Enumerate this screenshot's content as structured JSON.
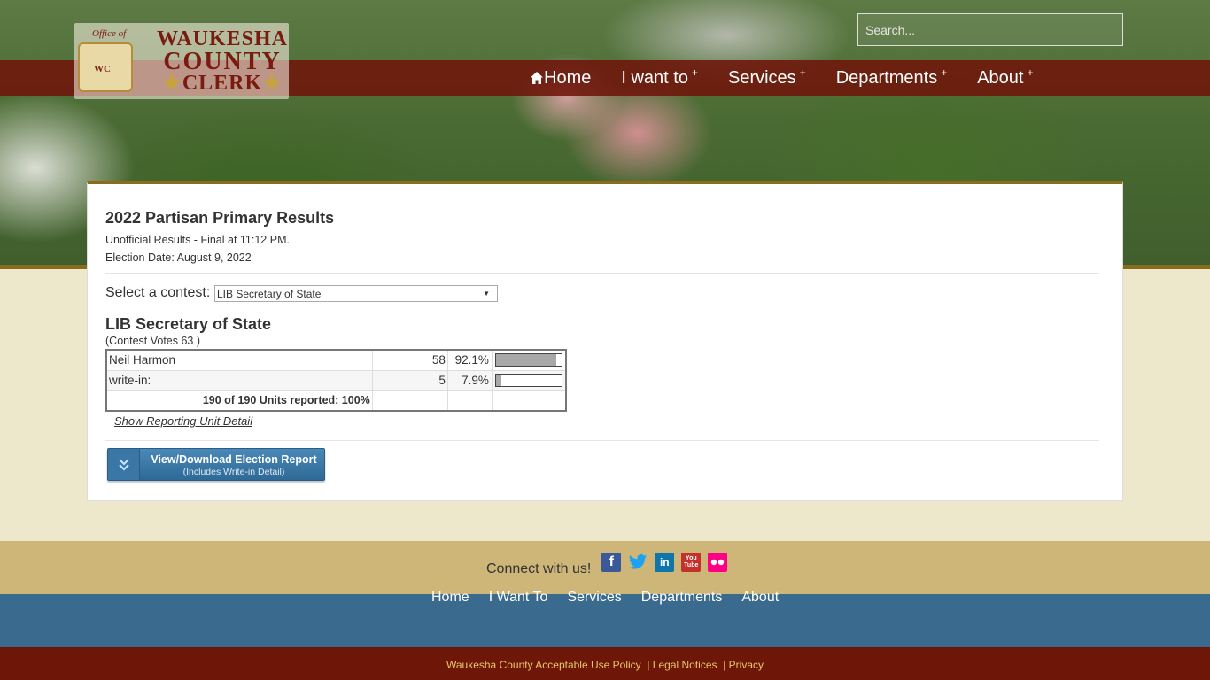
{
  "header": {
    "logo": {
      "line1": "WAUKESHA",
      "line2": "COUNTY",
      "line3": "CLERK",
      "office_text": "Office of",
      "seal_text": "WC"
    },
    "search_placeholder": "Search...",
    "nav": [
      {
        "label": "Home",
        "icon": "home-icon",
        "has_submenu": false
      },
      {
        "label": "I want to",
        "has_submenu": true
      },
      {
        "label": "Services",
        "has_submenu": true
      },
      {
        "label": "Departments",
        "has_submenu": true
      },
      {
        "label": "About",
        "has_submenu": true
      }
    ],
    "submenu_marker": "+"
  },
  "results_page": {
    "title": "2022 Partisan Primary Results",
    "status": "Unofficial Results - Final at 11:12 PM.",
    "election_date": "Election Date: August 9, 2022",
    "select_label": "Select a contest:",
    "selected_contest": "LIB Secretary of State",
    "contest_title": "LIB Secretary of State",
    "contest_votes": "(Contest Votes  63 )",
    "candidates": [
      {
        "name": "Neil Harmon",
        "votes": "58",
        "percent": "92.1%",
        "fraction": 0.921
      },
      {
        "name": "write-in:",
        "votes": "5",
        "percent": "7.9%",
        "fraction": 0.079
      }
    ],
    "units_reported": "190 of 190 Units reported: 100%",
    "detail_link": "Show Reporting Unit Detail",
    "download_button": {
      "main": "View/Download Election Report",
      "sub": "(Includes Write-in Detail)"
    }
  },
  "footer": {
    "connect_text": "Connect with us!",
    "social": [
      {
        "icon": "facebook-icon",
        "color": "#3b5998"
      },
      {
        "icon": "twitter-icon",
        "color": "#1da1f2"
      },
      {
        "icon": "linkedin-icon",
        "color": "#0e76a8"
      },
      {
        "icon": "youtube-icon",
        "color": "#c4302b"
      },
      {
        "icon": "flickr-icon",
        "color": "#ff0084"
      }
    ],
    "nav": [
      "Home",
      "I Want To",
      "Services",
      "Departments",
      "About"
    ],
    "legal": {
      "policy": "Waukesha County Acceptable Use Policy",
      "notices": "Legal Notices",
      "privacy": "Privacy",
      "separator": "|"
    }
  }
}
